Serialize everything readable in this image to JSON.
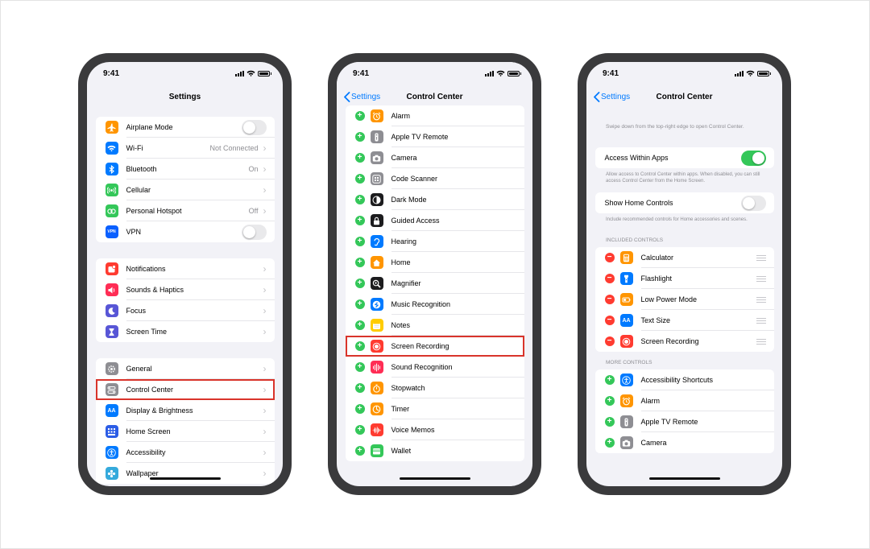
{
  "status_time": "9:41",
  "phone1": {
    "title": "Settings",
    "groups": [
      [
        {
          "label": "Airplane Mode",
          "icon": "airplane-icon",
          "color": "#ff9500",
          "accessory": "toggle",
          "toggle_on": false
        },
        {
          "label": "Wi-Fi",
          "icon": "wifi-icon",
          "color": "#007aff",
          "value": "Not Connected",
          "accessory": "chevron"
        },
        {
          "label": "Bluetooth",
          "icon": "bluetooth-icon",
          "color": "#007aff",
          "value": "On",
          "accessory": "chevron"
        },
        {
          "label": "Cellular",
          "icon": "cellular-icon",
          "color": "#34c759",
          "accessory": "chevron"
        },
        {
          "label": "Personal Hotspot",
          "icon": "hotspot-icon",
          "color": "#34c759",
          "value": "Off",
          "accessory": "chevron"
        },
        {
          "label": "VPN",
          "icon": "vpn-icon",
          "color": "#0a60ff",
          "glyph": "VPN",
          "accessory": "toggle",
          "toggle_on": false
        }
      ],
      [
        {
          "label": "Notifications",
          "icon": "notifications-icon",
          "color": "#ff3b30",
          "accessory": "chevron"
        },
        {
          "label": "Sounds & Haptics",
          "icon": "sounds-icon",
          "color": "#ff2d55",
          "accessory": "chevron"
        },
        {
          "label": "Focus",
          "icon": "moon-icon",
          "color": "#5856d6",
          "accessory": "chevron"
        },
        {
          "label": "Screen Time",
          "icon": "hourglass-icon",
          "color": "#5856d6",
          "accessory": "chevron"
        }
      ],
      [
        {
          "label": "General",
          "icon": "gear-icon",
          "color": "#8e8e93",
          "accessory": "chevron"
        },
        {
          "label": "Control Center",
          "icon": "control-center-icon",
          "color": "#8e8e93",
          "accessory": "chevron",
          "highlight": true
        },
        {
          "label": "Display & Brightness",
          "icon": "display-icon",
          "color": "#007aff",
          "glyph": "AA",
          "accessory": "chevron"
        },
        {
          "label": "Home Screen",
          "icon": "home-screen-icon",
          "color": "#2c5de6",
          "accessory": "chevron"
        },
        {
          "label": "Accessibility",
          "icon": "accessibility-icon",
          "color": "#007aff",
          "accessory": "chevron"
        },
        {
          "label": "Wallpaper",
          "icon": "wallpaper-icon",
          "color": "#35aadc",
          "accessory": "chevron"
        }
      ]
    ]
  },
  "phone2": {
    "back_label": "Settings",
    "title": "Control Center",
    "items": [
      {
        "label": "Alarm",
        "icon": "alarm-icon",
        "color": "#ff9500"
      },
      {
        "label": "Apple TV Remote",
        "icon": "tv-remote-icon",
        "color": "#8e8e93"
      },
      {
        "label": "Camera",
        "icon": "camera-icon",
        "color": "#8e8e93"
      },
      {
        "label": "Code Scanner",
        "icon": "qr-code-icon",
        "color": "#8e8e93"
      },
      {
        "label": "Dark Mode",
        "icon": "dark-mode-icon",
        "color": "#1c1c1e"
      },
      {
        "label": "Guided Access",
        "icon": "lock-icon",
        "color": "#1c1c1e"
      },
      {
        "label": "Hearing",
        "icon": "ear-icon",
        "color": "#007aff"
      },
      {
        "label": "Home",
        "icon": "home-icon",
        "color": "#ff9500"
      },
      {
        "label": "Magnifier",
        "icon": "magnifier-icon",
        "color": "#1c1c1e"
      },
      {
        "label": "Music Recognition",
        "icon": "shazam-icon",
        "color": "#007aff"
      },
      {
        "label": "Notes",
        "icon": "notes-icon",
        "color": "#ffcc00"
      },
      {
        "label": "Screen Recording",
        "icon": "screen-recording-icon",
        "color": "#ff3b30",
        "highlight": true
      },
      {
        "label": "Sound Recognition",
        "icon": "sound-recognition-icon",
        "color": "#ff2d55"
      },
      {
        "label": "Stopwatch",
        "icon": "stopwatch-icon",
        "color": "#ff9500"
      },
      {
        "label": "Timer",
        "icon": "timer-icon",
        "color": "#ff9500"
      },
      {
        "label": "Voice Memos",
        "icon": "voice-memos-icon",
        "color": "#ff3b30"
      },
      {
        "label": "Wallet",
        "icon": "wallet-icon",
        "color": "#34c759"
      }
    ]
  },
  "phone3": {
    "back_label": "Settings",
    "title": "Control Center",
    "intro": "Swipe down from the top-right edge to open Control Center.",
    "access_label": "Access Within Apps",
    "access_on": true,
    "access_footer": "Allow access to Control Center within apps. When disabled, you can still access Control Center from the Home Screen.",
    "home_label": "Show Home Controls",
    "home_on": false,
    "home_footer": "Include recommended controls for Home accessories and scenes.",
    "included_header": "INCLUDED CONTROLS",
    "included": [
      {
        "label": "Calculator",
        "icon": "calculator-icon",
        "color": "#ff9500"
      },
      {
        "label": "Flashlight",
        "icon": "flashlight-icon",
        "color": "#007aff"
      },
      {
        "label": "Low Power Mode",
        "icon": "battery-icon",
        "color": "#ff9500"
      },
      {
        "label": "Text Size",
        "icon": "text-size-icon",
        "color": "#007aff",
        "glyph": "AA"
      },
      {
        "label": "Screen Recording",
        "icon": "screen-recording-icon",
        "color": "#ff3b30"
      }
    ],
    "more_header": "MORE CONTROLS",
    "more": [
      {
        "label": "Accessibility Shortcuts",
        "icon": "accessibility-icon",
        "color": "#007aff"
      },
      {
        "label": "Alarm",
        "icon": "alarm-icon",
        "color": "#ff9500"
      },
      {
        "label": "Apple TV Remote",
        "icon": "tv-remote-icon",
        "color": "#8e8e93"
      },
      {
        "label": "Camera",
        "icon": "camera-icon",
        "color": "#8e8e93"
      }
    ]
  }
}
